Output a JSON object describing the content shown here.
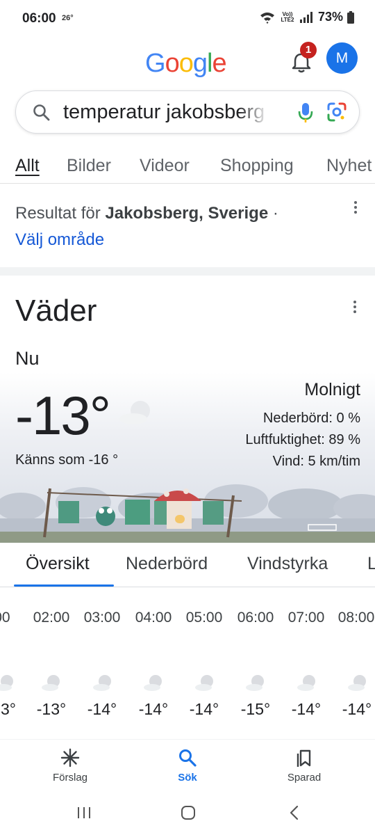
{
  "status": {
    "time": "06:00",
    "temp": "26°",
    "network": "Vo)) LTE2",
    "battery": "73%"
  },
  "header": {
    "logo": "Google",
    "notifications_count": "1",
    "avatar_letter": "M"
  },
  "search": {
    "query": "temperatur jakobsberg",
    "icons": [
      "search-icon",
      "mic-icon",
      "lens-icon"
    ]
  },
  "tabs": [
    {
      "label": "Allt",
      "active": true
    },
    {
      "label": "Bilder"
    },
    {
      "label": "Videor"
    },
    {
      "label": "Shopping"
    },
    {
      "label": "Nyhet"
    }
  ],
  "result_for": {
    "prefix": "Resultat för",
    "location": "Jakobsberg, Sverige",
    "separator": "·",
    "link": "Välj område"
  },
  "weather": {
    "title": "Väder",
    "now_label": "Nu",
    "temp": "-13°",
    "feels_like": "Känns som -16 °",
    "condition": "Molnigt",
    "precip": "Nederbörd: 0 %",
    "humidity": "Luftfuktighet: 89 %",
    "wind": "Vind: 5 km/tim"
  },
  "subtabs": [
    {
      "label": "Översikt",
      "active": true
    },
    {
      "label": "Nederbörd"
    },
    {
      "label": "Vindstyrka"
    },
    {
      "label": "L"
    }
  ],
  "hourly": {
    "hours": [
      ":00",
      "02:00",
      "03:00",
      "04:00",
      "05:00",
      "06:00",
      "07:00",
      "08:00"
    ],
    "temps": [
      "3°",
      "-13°",
      "-14°",
      "-14°",
      "-14°",
      "-15°",
      "-14°",
      "-14°"
    ]
  },
  "bottom_nav": [
    {
      "label": "Förslag",
      "icon": "sparkle-icon"
    },
    {
      "label": "Sök",
      "icon": "search-icon",
      "active": true
    },
    {
      "label": "Sparad",
      "icon": "bookmarks-icon"
    }
  ],
  "colors": {
    "accent": "#1a73e8",
    "badge": "#c5221f",
    "link": "#1558d6"
  }
}
